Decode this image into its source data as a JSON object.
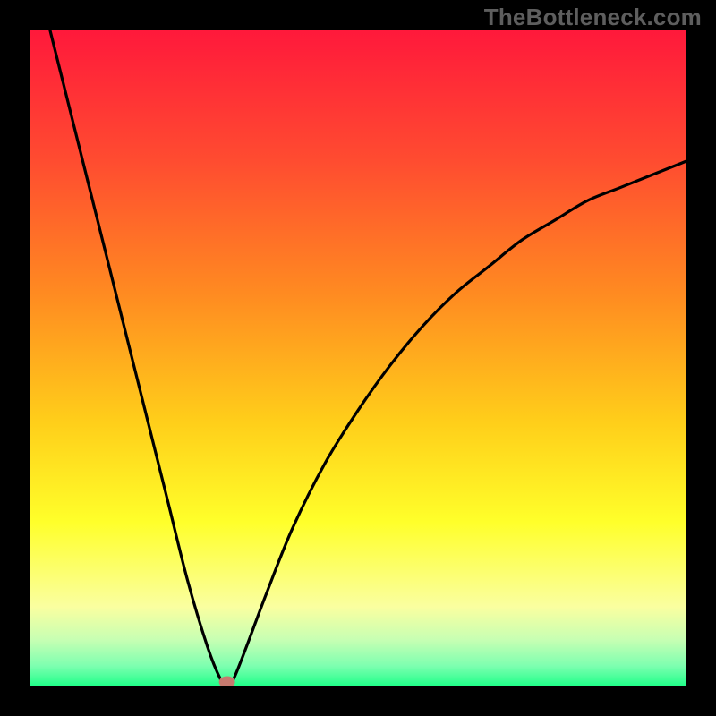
{
  "watermark": "TheBottleneck.com",
  "chart_data": {
    "type": "line",
    "title": "",
    "xlabel": "",
    "ylabel": "",
    "xlim": [
      0,
      100
    ],
    "ylim": [
      0,
      100
    ],
    "series": [
      {
        "name": "curve",
        "x": [
          3,
          6,
          9,
          12,
          15,
          18,
          21,
          24,
          27,
          29,
          30,
          31,
          33,
          36,
          40,
          45,
          50,
          55,
          60,
          65,
          70,
          75,
          80,
          85,
          90,
          95,
          100
        ],
        "y": [
          100,
          88,
          76,
          64,
          52,
          40,
          28,
          16,
          6,
          1,
          0,
          1,
          6,
          14,
          24,
          34,
          42,
          49,
          55,
          60,
          64,
          68,
          71,
          74,
          76,
          78,
          80
        ]
      }
    ],
    "gradient_stops": [
      {
        "offset": 0,
        "color": "#ff193b"
      },
      {
        "offset": 20,
        "color": "#ff4c30"
      },
      {
        "offset": 40,
        "color": "#ff8a21"
      },
      {
        "offset": 60,
        "color": "#ffcf1a"
      },
      {
        "offset": 75,
        "color": "#ffff2a"
      },
      {
        "offset": 88,
        "color": "#faffa0"
      },
      {
        "offset": 93,
        "color": "#c7ffb3"
      },
      {
        "offset": 97,
        "color": "#7dffb0"
      },
      {
        "offset": 100,
        "color": "#22ff8a"
      }
    ],
    "marker": {
      "x": 30,
      "y": 0,
      "color": "#c77a6f"
    }
  }
}
